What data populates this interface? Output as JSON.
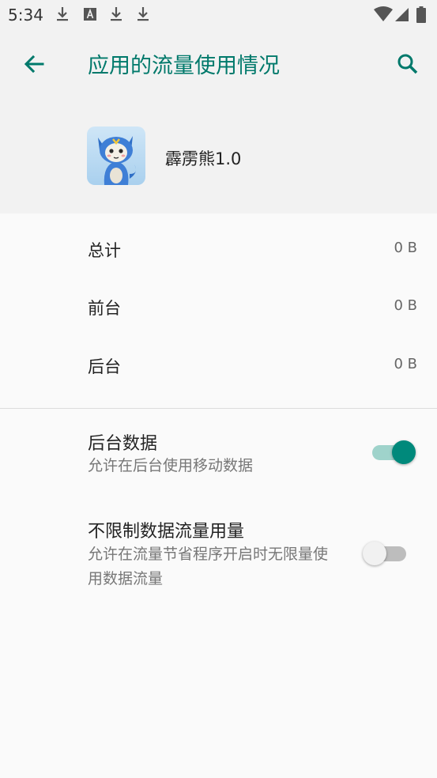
{
  "status_bar": {
    "time": "5:34",
    "icons": [
      "download-icon",
      "text-notification-icon",
      "download-icon",
      "download-icon",
      "wifi-icon",
      "signal-icon",
      "battery-icon"
    ]
  },
  "app_bar": {
    "title": "应用的流量使用情况",
    "back_icon": "arrow-left-icon",
    "search_icon": "search-icon"
  },
  "app_header": {
    "name": "霹雳熊1.0"
  },
  "usage": [
    {
      "label": "总计",
      "value": "0 B"
    },
    {
      "label": "前台",
      "value": "0 B"
    },
    {
      "label": "后台",
      "value": "0 B"
    }
  ],
  "settings": [
    {
      "title": "后台数据",
      "summary": "允许在后台使用移动数据",
      "enabled": true
    },
    {
      "title": "不限制数据流量用量",
      "summary": "允许在流量节省程序开启时无限量使用数据流量",
      "enabled": false
    }
  ],
  "colors": {
    "accent": "#00796b",
    "switch_on": "#00897b",
    "switch_track_on": "#9fd3cb",
    "switch_off": "#f1f1f1",
    "switch_track_off": "#bdbdbd",
    "background": "#fafafa",
    "header_background": "#f2f2f2"
  }
}
